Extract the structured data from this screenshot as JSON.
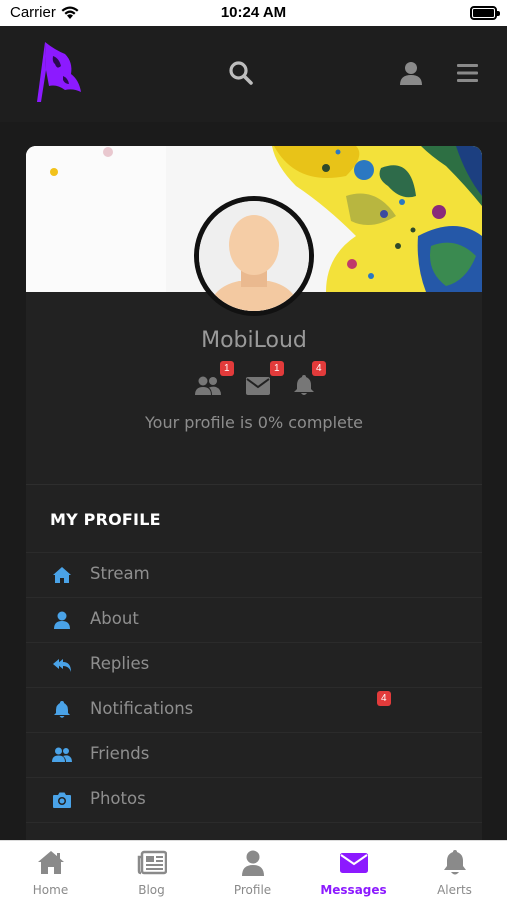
{
  "status_bar": {
    "carrier": "Carrier",
    "time": "10:24 AM"
  },
  "header": {
    "logo": "flag-logo",
    "search_icon": "search-icon",
    "user_icon": "user-icon",
    "menu_icon": "hamburger-icon"
  },
  "profile": {
    "name": "MobiLoud",
    "counts": [
      {
        "icon": "friends-icon",
        "count": "1"
      },
      {
        "icon": "mail-icon",
        "count": "1"
      },
      {
        "icon": "bell-icon",
        "count": "4"
      }
    ],
    "completion_text": "Your profile is 0% complete"
  },
  "section": {
    "title": "MY PROFILE"
  },
  "menu": [
    {
      "icon": "home-icon",
      "label": "Stream"
    },
    {
      "icon": "user-icon",
      "label": "About"
    },
    {
      "icon": "reply-all-icon",
      "label": "Replies"
    },
    {
      "icon": "bell-icon",
      "label": "Notifications",
      "badge": "4"
    },
    {
      "icon": "friends-icon",
      "label": "Friends"
    },
    {
      "icon": "camera-icon",
      "label": "Photos"
    }
  ],
  "tabs": [
    {
      "icon": "home-icon",
      "label": "Home",
      "active": false
    },
    {
      "icon": "newspaper-icon",
      "label": "Blog",
      "active": false
    },
    {
      "icon": "user-icon",
      "label": "Profile",
      "active": false
    },
    {
      "icon": "envelope-icon",
      "label": "Messages",
      "active": true
    },
    {
      "icon": "bell-icon",
      "label": "Alerts",
      "active": false
    }
  ],
  "colors": {
    "accent": "#8c1aff",
    "menu_icon": "#4aa3e8",
    "badge": "#e23b3b",
    "background": "#1b1b1b"
  }
}
